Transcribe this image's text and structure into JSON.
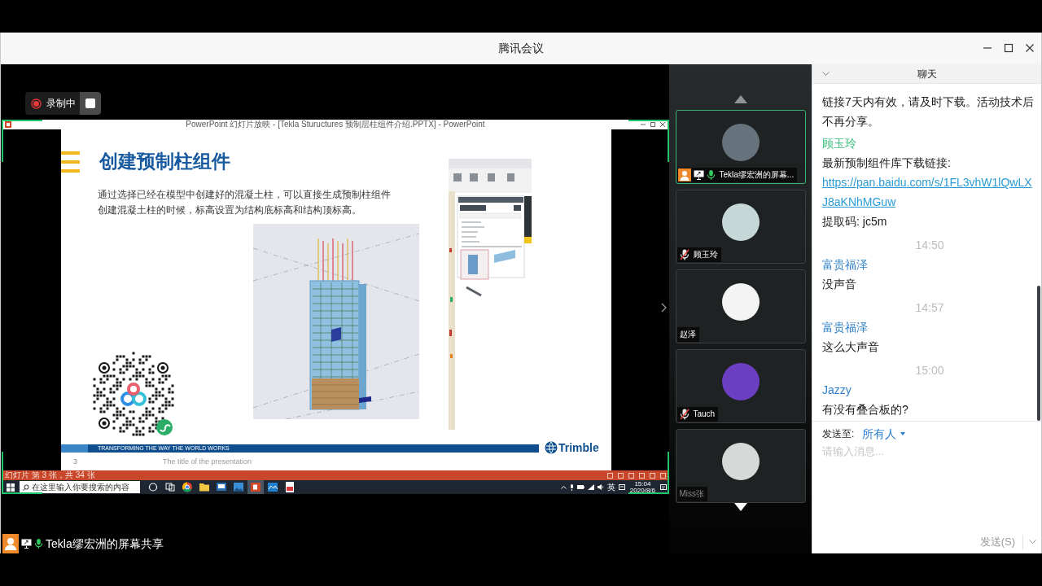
{
  "window": {
    "title": "腾讯会议"
  },
  "recording": {
    "label": "录制中"
  },
  "shared_screen": {
    "app_title": "PowerPoint 幻灯片放映 - [Tekla Stuructures 预制层柱组件介绍.PPTX] - PowerPoint",
    "slide": {
      "title": "创建预制柱组件",
      "body": [
        "通过选择已经在模型中创建好的混凝土柱，可以直接生成预制柱组件",
        "创建混凝土柱的时候，标高设置为结构底标高和结构顶标高。"
      ],
      "banner": "TRANSFORMING THE WAY THE WORLD WORKS",
      "logo": "Trimble",
      "page_number": "3",
      "footer": "The title of the presentation"
    },
    "status_bar": "幻灯片 第 3 张，共 34 张",
    "taskbar": {
      "search_placeholder": "在这里输入你要搜索的内容",
      "apps": [
        {
          "kind": "circle",
          "selected": false
        },
        {
          "kind": "taskview",
          "selected": false
        },
        {
          "kind": "browser",
          "selected": false
        },
        {
          "kind": "folder",
          "selected": false
        },
        {
          "kind": "monitor",
          "selected": false
        },
        {
          "kind": "picture",
          "selected": false
        },
        {
          "kind": "presentation",
          "selected": true
        },
        {
          "kind": "waves",
          "selected": false
        },
        {
          "kind": "document",
          "selected": false
        }
      ],
      "input_method": "英",
      "time": "15:04",
      "date": "2020/8/6"
    }
  },
  "sharer": {
    "label": "Tekla缪宏洲的屏幕共享"
  },
  "participants": [
    {
      "name": "Tekla缪宏洲的屏幕...",
      "selected": true,
      "host": true,
      "sharing": true,
      "mic_on": true,
      "muted": false,
      "dimmed": false,
      "color": "#66737c"
    },
    {
      "name": "顾玉玲",
      "selected": false,
      "host": false,
      "sharing": false,
      "mic_on": false,
      "muted": true,
      "dimmed": false,
      "color": "#c6d7d8"
    },
    {
      "name": "赵泽",
      "selected": false,
      "host": false,
      "sharing": false,
      "mic_on": false,
      "muted": false,
      "dimmed": false,
      "color": "#f4f4f4"
    },
    {
      "name": "Tauch",
      "selected": false,
      "host": false,
      "sharing": false,
      "mic_on": false,
      "muted": true,
      "dimmed": false,
      "color": "#6b3ec2"
    },
    {
      "name": "Miss张",
      "selected": false,
      "host": false,
      "sharing": false,
      "mic_on": false,
      "muted": false,
      "dimmed": true,
      "color": "#d6d9d7"
    }
  ],
  "chat": {
    "title": "聊天",
    "messages": [
      {
        "kind": "message",
        "text": "链接7天内有效，请及时下载。活动技术后不再分享。"
      },
      {
        "kind": "message",
        "sender": "顾玉玲",
        "color": "#3dbb7c",
        "text": "最新预制组件库下载链接:",
        "link": "https://pan.baidu.com/s/1FL3vhW1lQwLXJ8aKNhMGuw",
        "suffix": "提取码: jc5m"
      },
      {
        "kind": "time",
        "text": "14:50"
      },
      {
        "kind": "message",
        "sender": "富贵福泽",
        "color": "#2f80c8",
        "text": "没声音"
      },
      {
        "kind": "time",
        "text": "14:57"
      },
      {
        "kind": "message",
        "sender": "富贵福泽",
        "color": "#2f80c8",
        "text": "这么大声音"
      },
      {
        "kind": "time",
        "text": "15:00"
      },
      {
        "kind": "message",
        "sender": "Jazzy",
        "color": "#2f80c8",
        "text": "有没有叠合板的?"
      }
    ],
    "send_to_label": "发送至:",
    "send_to": "所有人",
    "placeholder": "请输入消息...",
    "send_button": "发送(S)"
  }
}
